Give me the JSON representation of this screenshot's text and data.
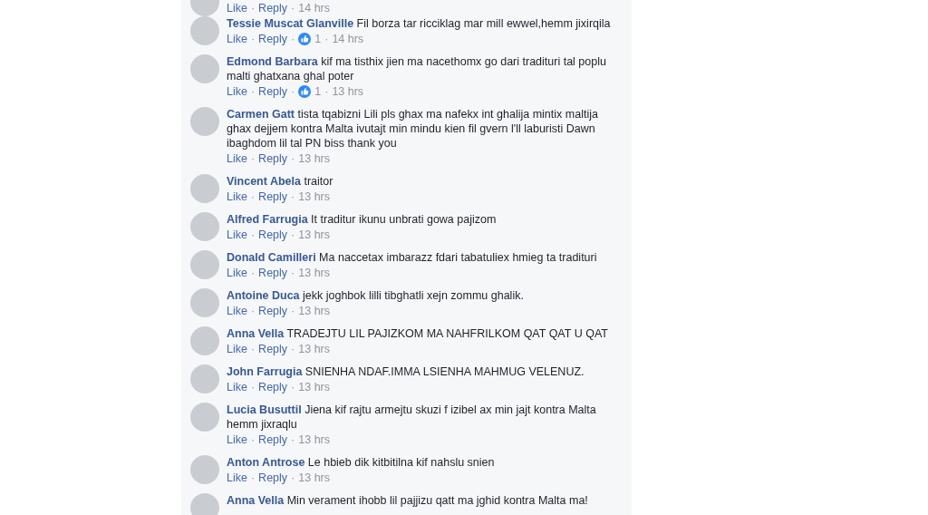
{
  "comments": [
    {
      "like": "Like",
      "reply": "Reply",
      "time": "14 hrs"
    },
    {
      "author": "Tessie Muscat Glanville",
      "text": "Fil borza tar ricciklag mar mill ewwel,hemm jixirqila",
      "like": "Like",
      "reply": "Reply",
      "likes": "1",
      "time": "14 hrs"
    },
    {
      "author": "Edmond Barbara",
      "text": "kif ma tisthix jien ma nacethomx go dari tradituri tal poplu malti ghatxana ghal poter",
      "like": "Like",
      "reply": "Reply",
      "likes": "1",
      "time": "13 hrs"
    },
    {
      "author": "Carmen Gatt",
      "text": "tista tqabizni Lili pls ghax ma nafekx int ghalija mintix maltija ghax dejjem kontra Malta ivutajt min mindu kien fil gvern l'll laburisti Dawn ibaghdom lil tal PN biss thank you",
      "like": "Like",
      "reply": "Reply",
      "time": "13 hrs"
    },
    {
      "author": "Vincent Abela",
      "text": "traitor",
      "like": "Like",
      "reply": "Reply",
      "time": "13 hrs"
    },
    {
      "author": "Alfred Farrugia",
      "text": "It traditur ikunu unbrati gowa pajizom",
      "like": "Like",
      "reply": "Reply",
      "time": "13 hrs"
    },
    {
      "author": "Donald Camilleri",
      "text": "Ma naccetax imbarazz fdari tabatuliex hmieg ta tradituri",
      "like": "Like",
      "reply": "Reply",
      "time": "13 hrs"
    },
    {
      "author": "Antoine Duca",
      "text": "jekk joghbok lilli tibghatli xejn zommu ghalik.",
      "like": "Like",
      "reply": "Reply",
      "time": "13 hrs"
    },
    {
      "author": "Anna Vella",
      "text": "TRADEJTU LIL PAJIZKOM MA NAHFRILKOM QAT QAT U QAT",
      "like": "Like",
      "reply": "Reply",
      "time": "13 hrs"
    },
    {
      "author": "John Farrugia",
      "text": "SNIENHA NDAF.IMMA LSIENHA MAHMUG VELENUZ.",
      "like": "Like",
      "reply": "Reply",
      "time": "13 hrs"
    },
    {
      "author": "Lucia Busuttil",
      "text": "Jiena kif rajtu armejtu skuzi f izibel ax min jajt kontra Malta hemm jixraqlu",
      "like": "Like",
      "reply": "Reply",
      "time": "13 hrs"
    },
    {
      "author": "Anton Antrose",
      "text": "Le hbieb dik kitbitilna kif nahslu snien",
      "like": "Like",
      "reply": "Reply",
      "time": "13 hrs"
    },
    {
      "author": "Anna Vella",
      "text": "Min verament ihobb lil pajjizu qatt ma jghid kontra Malta ma!"
    }
  ],
  "separator": "·"
}
